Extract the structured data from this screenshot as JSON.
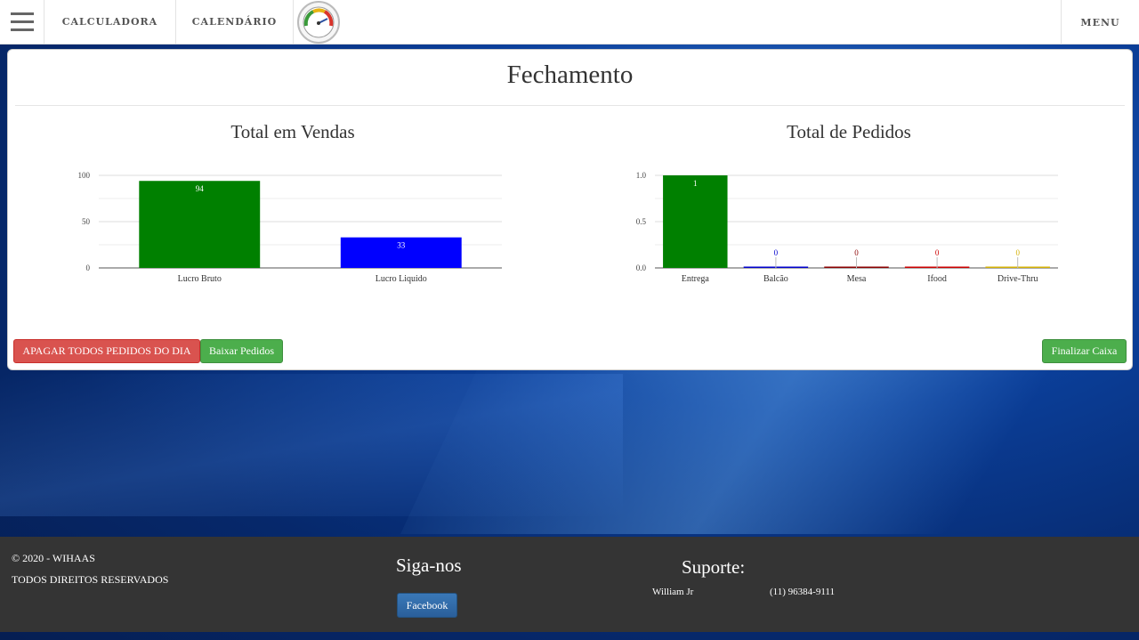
{
  "nav": {
    "calculator": "CALCULADORA",
    "calendar": "CALENDÁRIO",
    "menu": "MENU"
  },
  "card": {
    "title": "Fechamento"
  },
  "charts": {
    "vendas_title": "Total em Vendas",
    "pedidos_title": "Total de Pedidos"
  },
  "chart_data": [
    {
      "type": "bar",
      "title": "Total em Vendas",
      "categories": [
        "Lucro Bruto",
        "Lucro Liquido"
      ],
      "values": [
        94,
        33
      ],
      "colors": [
        "#008000",
        "#0000ff"
      ],
      "ylim": [
        0,
        100
      ],
      "yticks": [
        "0",
        "50",
        "100"
      ],
      "grid": true
    },
    {
      "type": "bar",
      "title": "Total de Pedidos",
      "categories": [
        "Entrega",
        "Balcão",
        "Mesa",
        "Ifood",
        "Drive-Thru"
      ],
      "values": [
        1,
        0,
        0,
        0,
        0
      ],
      "colors": [
        "#008000",
        "#0000cc",
        "#8b0000",
        "#cc0000",
        "#d4b106"
      ],
      "ylim": [
        0,
        1.0
      ],
      "yticks": [
        "0.0",
        "0.5",
        "1.0"
      ],
      "grid": true
    }
  ],
  "buttons": {
    "delete_all": "APAGAR TODOS PEDIDOS DO DIA",
    "download": "Baixar Pedidos",
    "finalize": "Finalizar Caixa"
  },
  "footer": {
    "copyright": "© 2020 - WIHAAS",
    "rights": "TODOS DIREITOS RESERVADOS",
    "follow_heading": "Siga-nos",
    "facebook": "Facebook",
    "support_heading": "Suporte:",
    "support_name": "William Jr",
    "support_phone": "(11) 96384-9111"
  }
}
